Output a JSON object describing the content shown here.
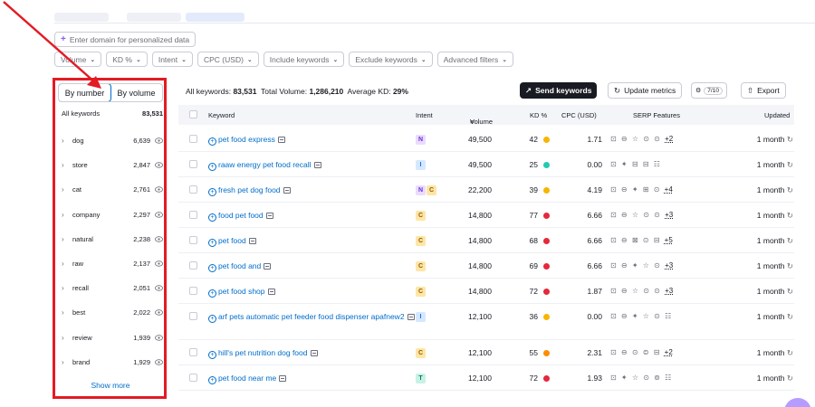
{
  "domain_input": {
    "placeholder": "Enter domain for personalized data"
  },
  "filters": [
    "Volume",
    "KD %",
    "Intent",
    "CPC (USD)",
    "Include keywords",
    "Exclude keywords",
    "Advanced filters"
  ],
  "sidebar": {
    "toggle": {
      "by_number": "By number",
      "by_volume": "By volume",
      "active": "by_number"
    },
    "all_label": "All keywords",
    "all_count": "83,531",
    "groups": [
      {
        "label": "dog",
        "count": "6,639"
      },
      {
        "label": "store",
        "count": "2,847"
      },
      {
        "label": "cat",
        "count": "2,761"
      },
      {
        "label": "company",
        "count": "2,297"
      },
      {
        "label": "natural",
        "count": "2,238"
      },
      {
        "label": "raw",
        "count": "2,137"
      },
      {
        "label": "recall",
        "count": "2,051"
      },
      {
        "label": "best",
        "count": "2,022"
      },
      {
        "label": "review",
        "count": "1,939"
      },
      {
        "label": "brand",
        "count": "1,929"
      }
    ],
    "show_more": "Show more"
  },
  "toolbar": {
    "all_keywords_label": "All keywords:",
    "all_keywords_value": "83,531",
    "total_volume_label": "Total Volume:",
    "total_volume_value": "1,286,210",
    "avg_kd_label": "Average KD:",
    "avg_kd_value": "29%",
    "send_keywords": "Send keywords",
    "update_metrics": "Update metrics",
    "columns_count": "7/10",
    "export": "Export"
  },
  "table": {
    "headers": {
      "keyword": "Keyword",
      "intent": "Intent",
      "volume": "Volume",
      "kd": "KD %",
      "cpc": "CPC (USD)",
      "serp": "SERP Features",
      "updated": "Updated"
    },
    "rows": [
      {
        "keyword": "pet food express",
        "intents": [
          "N"
        ],
        "volume": "49,500",
        "kd": "42",
        "kd_color": "#f7b500",
        "cpc": "1.71",
        "serp": "⊡ ⊖ ☆ ⊙ ⊙",
        "serp_more": "+2",
        "updated": "1 month"
      },
      {
        "keyword": "raaw energy pet food recall",
        "intents": [
          "I"
        ],
        "volume": "49,500",
        "kd": "25",
        "kd_color": "#25c8b4",
        "cpc": "0.00",
        "serp": "⊡ ✦ ⊟ ⊟ ☷",
        "serp_more": "",
        "updated": "1 month"
      },
      {
        "keyword": "fresh pet dog food",
        "intents": [
          "N",
          "C"
        ],
        "volume": "22,200",
        "kd": "39",
        "kd_color": "#f7b500",
        "cpc": "4.19",
        "serp": "⊡ ⊖ ✦ ⊞ ⊙",
        "serp_more": "+4",
        "updated": "1 month"
      },
      {
        "keyword": "food pet food",
        "intents": [
          "C"
        ],
        "volume": "14,800",
        "kd": "77",
        "kd_color": "#e5283b",
        "cpc": "6.66",
        "serp": "⊡ ⊖ ☆ ⊙ ⊙",
        "serp_more": "+3",
        "updated": "1 month"
      },
      {
        "keyword": "pet food",
        "intents": [
          "C"
        ],
        "volume": "14,800",
        "kd": "68",
        "kd_color": "#e5283b",
        "cpc": "6.66",
        "serp": "⊡ ⊖ ⊠ ⊙ ⊟",
        "serp_more": "+5",
        "updated": "1 month"
      },
      {
        "keyword": "pet food and",
        "intents": [
          "C"
        ],
        "volume": "14,800",
        "kd": "69",
        "kd_color": "#e5283b",
        "cpc": "6.66",
        "serp": "⊡ ⊖ ✦ ☆ ⊙",
        "serp_more": "+3",
        "updated": "1 month"
      },
      {
        "keyword": "pet food shop",
        "intents": [
          "C"
        ],
        "volume": "14,800",
        "kd": "72",
        "kd_color": "#e5283b",
        "cpc": "1.87",
        "serp": "⊡ ⊖ ☆ ⊙ ⊙",
        "serp_more": "+3",
        "updated": "1 month"
      },
      {
        "keyword": "arf pets automatic pet feeder food dispenser apafnew2",
        "intents": [
          "I"
        ],
        "volume": "12,100",
        "kd": "36",
        "kd_color": "#f7b500",
        "cpc": "0.00",
        "serp": "⊡ ⊖ ✦ ☆ ⊙ ☷",
        "serp_more": "",
        "updated": "1 month"
      },
      {
        "keyword": "hill's pet nutrition dog food",
        "intents": [
          "C"
        ],
        "volume": "12,100",
        "kd": "55",
        "kd_color": "#ff8c00",
        "cpc": "2.31",
        "serp": "⊡ ⊖ ⊙ ⊜ ⊟",
        "serp_more": "+2",
        "updated": "1 month"
      },
      {
        "keyword": "pet food near me",
        "intents": [
          "T"
        ],
        "volume": "12,100",
        "kd": "72",
        "kd_color": "#e5283b",
        "cpc": "1.93",
        "serp": "⊡ ✦ ☆ ⊙ ⊚ ☷",
        "serp_more": "",
        "updated": "1 month"
      }
    ]
  },
  "intent_colors": {
    "N": {
      "bg": "#e9dcff",
      "fg": "#6b2fd6"
    },
    "I": {
      "bg": "#d5e8ff",
      "fg": "#1e6fd9"
    },
    "C": {
      "bg": "#ffe5a6",
      "fg": "#8a5d00"
    },
    "T": {
      "bg": "#c8f2e6",
      "fg": "#0c7a5c"
    }
  },
  "annotation_color": "#e31b23"
}
